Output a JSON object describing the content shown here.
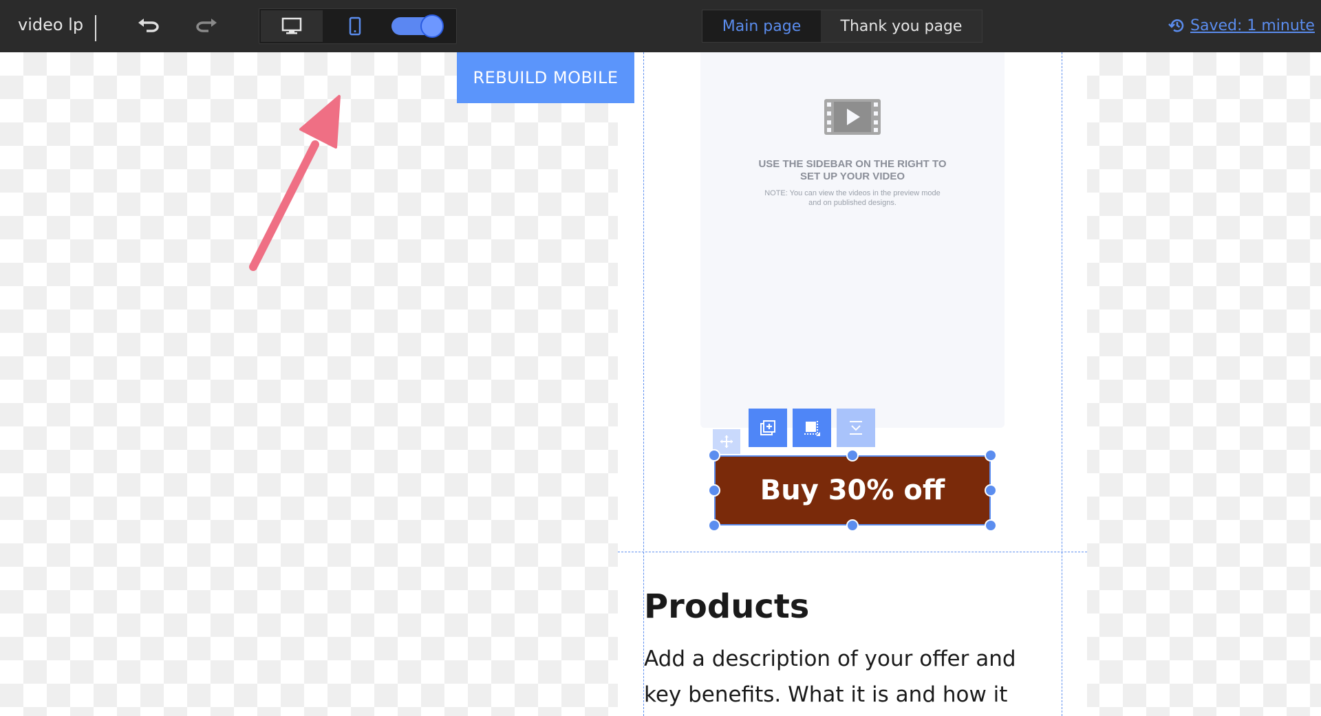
{
  "header": {
    "project_name": "video lp",
    "undo_icon": "undo-icon",
    "redo_icon": "redo-icon",
    "device_desktop_icon": "desktop-monitor-icon",
    "device_mobile_icon": "mobile-phone-icon",
    "mobile_toggle_on": true,
    "tabs": [
      {
        "label": "Main page",
        "active": true
      },
      {
        "label": "Thank you page",
        "active": false
      }
    ],
    "saved_label": "Saved: 1 minute",
    "saved_icon": "history-icon"
  },
  "canvas": {
    "rebuild_label": "REBUILD MOBILE",
    "video": {
      "icon": "video-film-icon",
      "title_line1": "USE THE SIDEBAR ON THE RIGHT TO",
      "title_line2": "SET UP YOUR VIDEO",
      "note_line1": "NOTE: You can view the videos in the preview mode",
      "note_line2": "and on published designs."
    },
    "mini_toolbar": {
      "add_icon": "add-element-icon",
      "copy_icon": "duplicate-icon",
      "collapse_icon": "collapse-icon",
      "move_icon": "move-icon"
    },
    "buy_button_label": "Buy 30% off",
    "products_title": "Products",
    "products_desc_line1": "Add a description of your offer and",
    "products_desc_line2": "key benefits. What it is and how it"
  },
  "colors": {
    "toolbar_bg": "#2b2b2b",
    "accent": "#5b8def",
    "rebuild_bg": "#5b95fb",
    "buy_button_bg": "#7a2a0a",
    "annotation_arrow": "#ef6f84"
  }
}
